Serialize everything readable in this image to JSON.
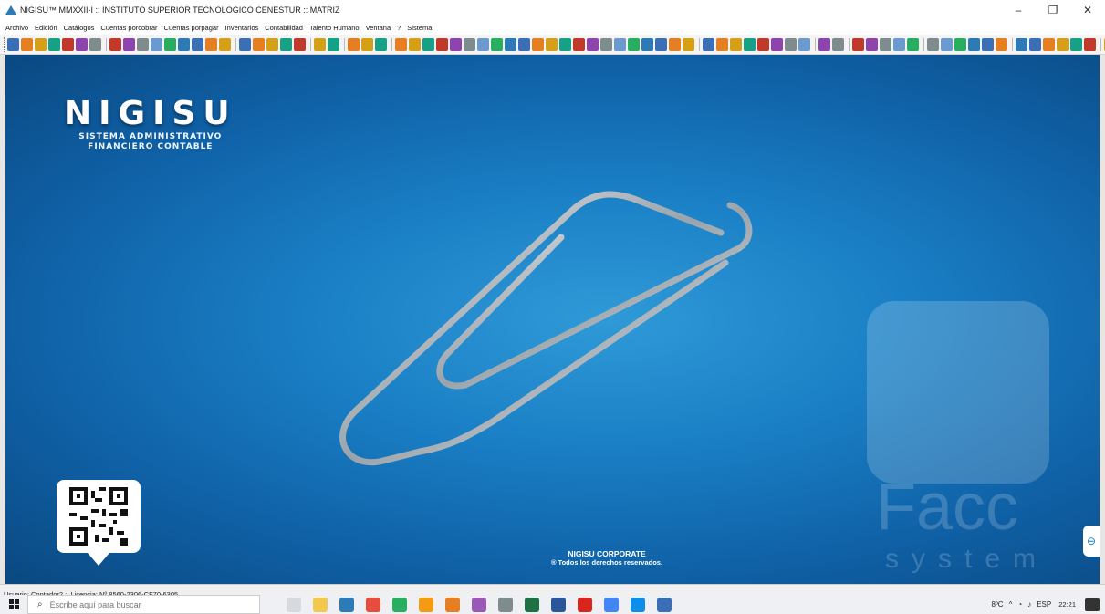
{
  "window": {
    "title": "NIGISU™ MMXXII-I :: INSTITUTO SUPERIOR TECNOLOGICO CENESTUR :: MATRIZ",
    "minimize_glyph": "–",
    "maximize_glyph": "❐",
    "close_glyph": "✕"
  },
  "menu": {
    "items": [
      {
        "label": "Archivo"
      },
      {
        "label": "Edición"
      },
      {
        "label": "Catálogos"
      },
      {
        "label": "Cuentas porcobrar"
      },
      {
        "label": "Cuentas porpagar"
      },
      {
        "label": "Inventarios"
      },
      {
        "label": "Contabilidad"
      },
      {
        "label": "Talento Humano"
      },
      {
        "label": "Ventana"
      },
      {
        "label": "?"
      },
      {
        "label": "Sistema"
      }
    ]
  },
  "toolbar": {
    "accent_colors": [
      "#3a6fb5",
      "#6a9ad0",
      "#c0392b",
      "#e67e22",
      "#27ae60",
      "#8e44ad",
      "#d4a017",
      "#2c7bb6",
      "#7f8c8d",
      "#16a085"
    ]
  },
  "splash": {
    "brand": "NIGISU",
    "subtitle_line1": "SISTEMA ADMINISTRATIVO",
    "subtitle_line2": "FINANCIERO CONTABLE",
    "corporate": "NIGISU CORPORATE",
    "rights": "® Todos los derechos reservados.",
    "watermark_text": "Facc",
    "watermark_sub": "system",
    "side_tab_icon": "⊖"
  },
  "statusbar": {
    "text": "Usuario: Contador2 :: Licencia: Nº 8560-2306-CF70-6305"
  },
  "taskbar": {
    "search_placeholder": "Escribe aquí para buscar",
    "search_icon": "⌕",
    "weather": "8ºC",
    "language": "ESP",
    "time": "22:21"
  },
  "colors": {
    "desktop_bg": "#1a7fc5",
    "taskbar_bg": "#eef0f4"
  }
}
